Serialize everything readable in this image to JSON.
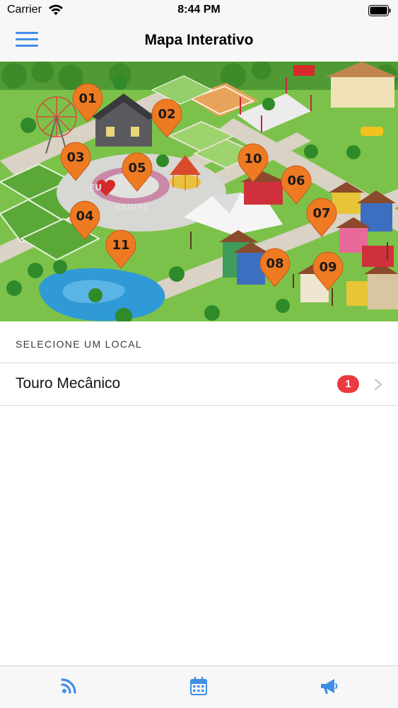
{
  "status_bar": {
    "carrier": "Carrier",
    "time": "8:44 PM"
  },
  "nav": {
    "title": "Mapa Interativo",
    "menu_icon": "hamburger-menu-icon"
  },
  "map": {
    "sign_text": "SAUIPE",
    "sign_prefix": "EU",
    "pins": [
      {
        "label": "01"
      },
      {
        "label": "02"
      },
      {
        "label": "03"
      },
      {
        "label": "04"
      },
      {
        "label": "05"
      },
      {
        "label": "06"
      },
      {
        "label": "07"
      },
      {
        "label": "08"
      },
      {
        "label": "09"
      },
      {
        "label": "10"
      },
      {
        "label": "11"
      }
    ],
    "pin_color": "#ee7a22"
  },
  "section": {
    "header": "SELECIONE UM LOCAL"
  },
  "list": {
    "items": [
      {
        "title": "Touro Mecânico",
        "badge": "1"
      }
    ]
  },
  "colors": {
    "accent": "#3f8ee6",
    "badge": "#ea3a3f",
    "pin": "#ee7a22"
  },
  "tab_bar": {
    "items": [
      {
        "icon": "rss-feed-icon"
      },
      {
        "icon": "calendar-icon"
      },
      {
        "icon": "megaphone-icon"
      }
    ]
  }
}
